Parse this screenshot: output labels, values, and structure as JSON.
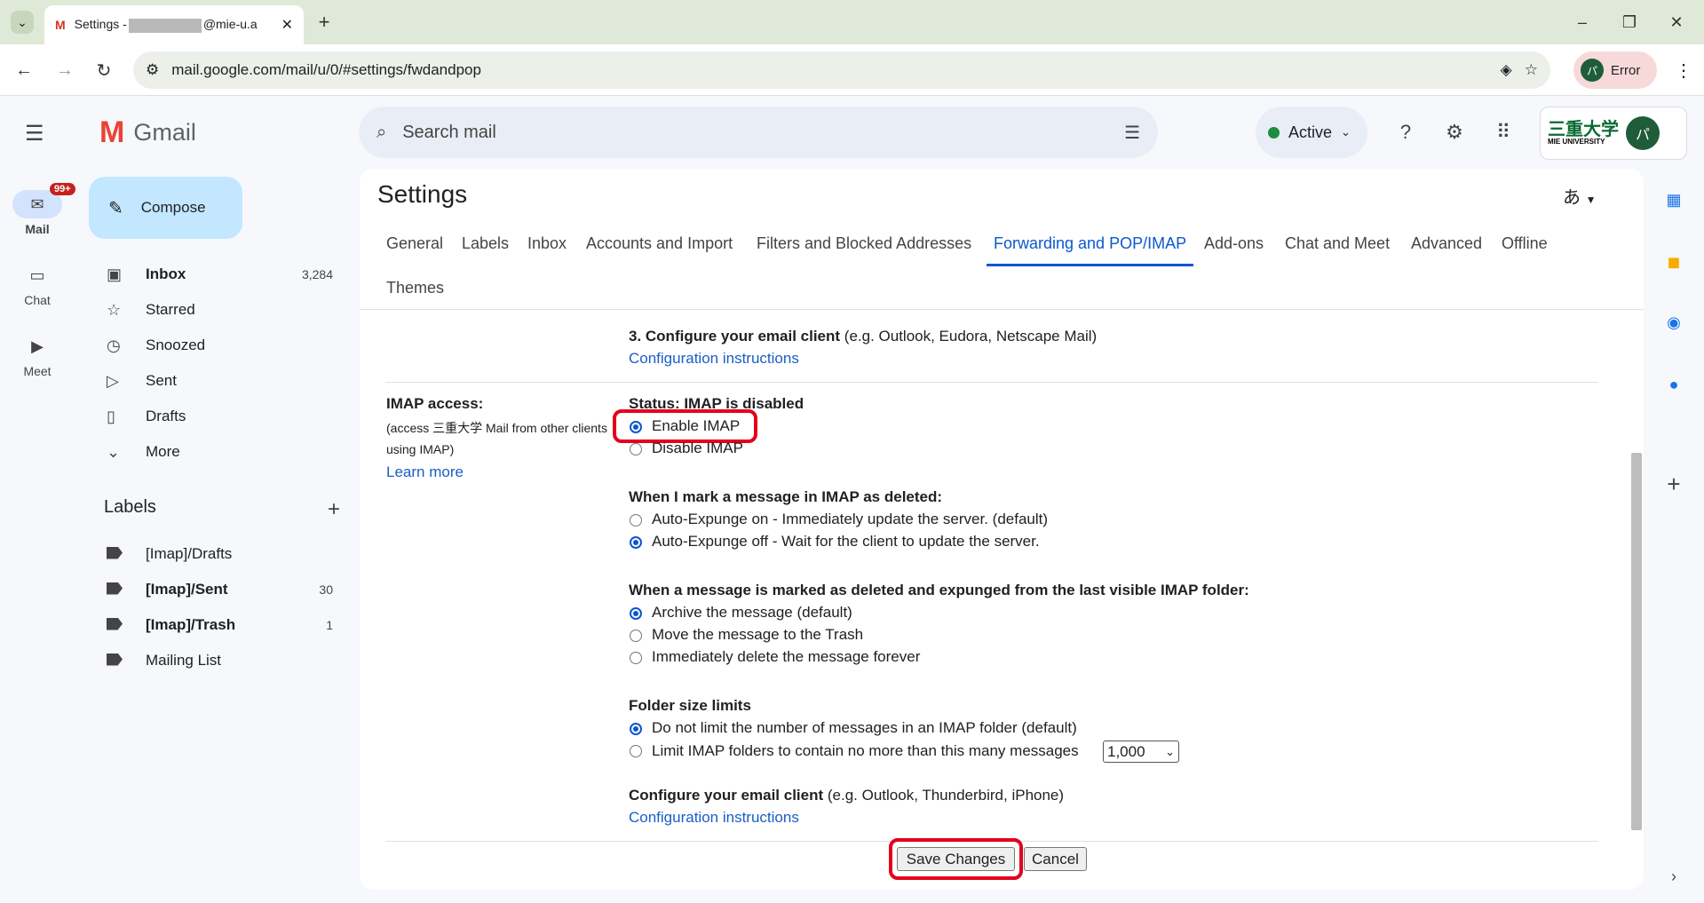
{
  "browser": {
    "tab_title_prefix": "Settings -",
    "tab_title_suffix": "@mie-u.a",
    "url": "mail.google.com/mail/u/0/#settings/fwdandpop",
    "profile_status": "Error",
    "profile_initial": "パ"
  },
  "rail": {
    "mail_label": "Mail",
    "mail_badge": "99+",
    "chat_label": "Chat",
    "meet_label": "Meet"
  },
  "gmail": {
    "logo_text": "Gmail",
    "compose_label": "Compose",
    "nav": [
      {
        "label": "Inbox",
        "count": "3,284",
        "icon": "inbox-icon"
      },
      {
        "label": "Starred",
        "count": "",
        "icon": "star-icon"
      },
      {
        "label": "Snoozed",
        "count": "",
        "icon": "clock-icon"
      },
      {
        "label": "Sent",
        "count": "",
        "icon": "send-icon"
      },
      {
        "label": "Drafts",
        "count": "",
        "icon": "draft-icon"
      },
      {
        "label": "More",
        "count": "",
        "icon": "chevron-down-icon"
      }
    ],
    "labels_heading": "Labels",
    "labels": [
      {
        "label": "[Imap]/Drafts",
        "count": ""
      },
      {
        "label": "[Imap]/Sent",
        "count": "30"
      },
      {
        "label": "[Imap]/Trash",
        "count": "1"
      },
      {
        "label": "Mailing List",
        "count": ""
      }
    ]
  },
  "header": {
    "search_placeholder": "Search mail",
    "status": "Active",
    "org_logo": "三重大学",
    "org_sub": "MIE UNIVERSITY",
    "user_initial": "パ"
  },
  "settings": {
    "title": "Settings",
    "lang": "あ",
    "tabs": [
      "General",
      "Labels",
      "Inbox",
      "Accounts and Import",
      "Filters and Blocked Addresses",
      "Forwarding and POP/IMAP",
      "Add-ons",
      "Chat and Meet",
      "Advanced",
      "Offline",
      "Themes"
    ],
    "active_tab": "Forwarding and POP/IMAP",
    "pop_step3_bold": "3. Configure your email client",
    "pop_step3_rest": " (e.g. Outlook, Eudora, Netscape Mail)",
    "config_link_1": "Configuration instructions",
    "imap_title": "IMAP access:",
    "imap_desc_1": "(access 三重大学 Mail from other clients",
    "imap_desc_2": "using IMAP)",
    "learn_more": "Learn more",
    "status": "Status: IMAP is disabled",
    "enable_imap": "Enable IMAP",
    "disable_imap": "Disable IMAP",
    "deleted_heading": "When I mark a message in IMAP as deleted:",
    "expunge_on": "Auto-Expunge on - Immediately update the server. (default)",
    "expunge_off": "Auto-Expunge off - Wait for the client to update the server.",
    "expunged_heading": "When a message is marked as deleted and expunged from the last visible IMAP folder:",
    "archive": "Archive the message (default)",
    "move_trash": "Move the message to the Trash",
    "delete_forever": "Immediately delete the message forever",
    "folder_heading": "Folder size limits",
    "no_limit": "Do not limit the number of messages in an IMAP folder (default)",
    "limit": "Limit IMAP folders to contain no more than this many messages",
    "limit_value": "1,000",
    "client_bold": "Configure your email client",
    "client_rest": " (e.g. Outlook, Thunderbird, iPhone)",
    "config_link_2": "Configuration instructions",
    "save": "Save Changes",
    "cancel": "Cancel"
  }
}
